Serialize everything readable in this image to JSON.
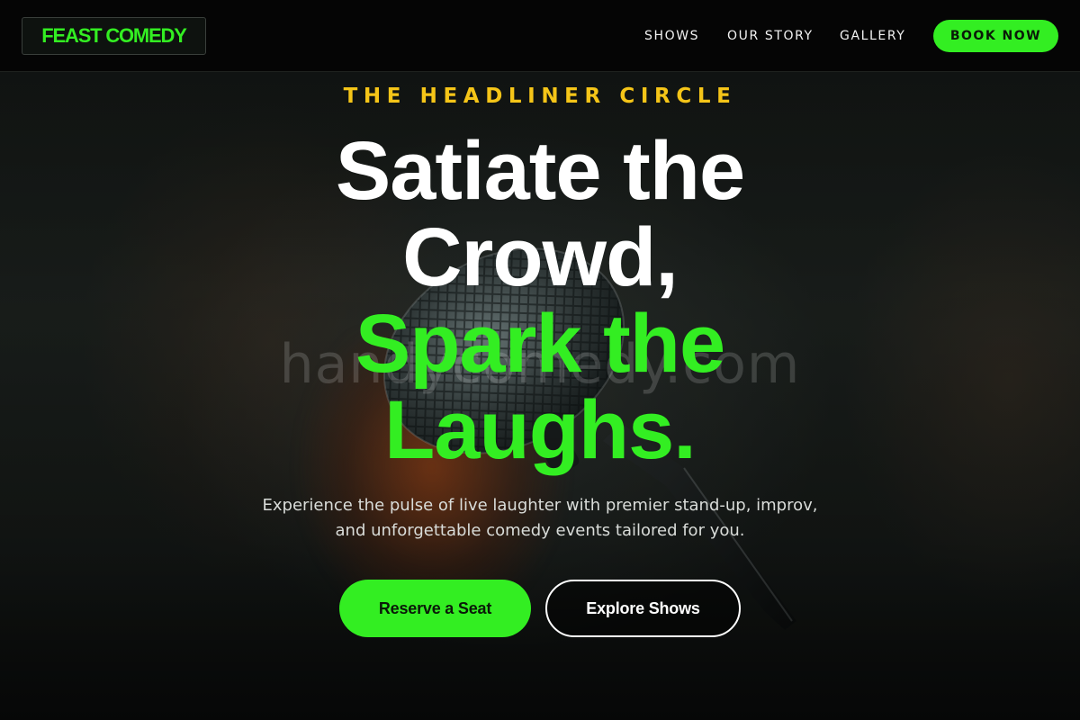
{
  "brand": {
    "logo_text": "FEAST COMEDY",
    "accent": "#33ee22",
    "highlight": "#f5c518"
  },
  "nav": {
    "links": [
      "SHOWS",
      "OUR STORY",
      "GALLERY"
    ],
    "cta": "BOOK NOW"
  },
  "hero": {
    "eyebrow": "THE HEADLINER CIRCLE",
    "headline_lines": [
      "Satiate the",
      "Crowd,",
      "Spark the",
      "Laughs."
    ],
    "subtitle_lines": [
      "Experience the pulse of live laughter with premier stand-up, improv,",
      "and unforgettable comedy events tailored for you."
    ],
    "primary_cta": "Reserve a Seat",
    "secondary_cta": "Explore Shows",
    "watermark": "handycomedy.com",
    "background_image": "microphone-on-stage"
  }
}
